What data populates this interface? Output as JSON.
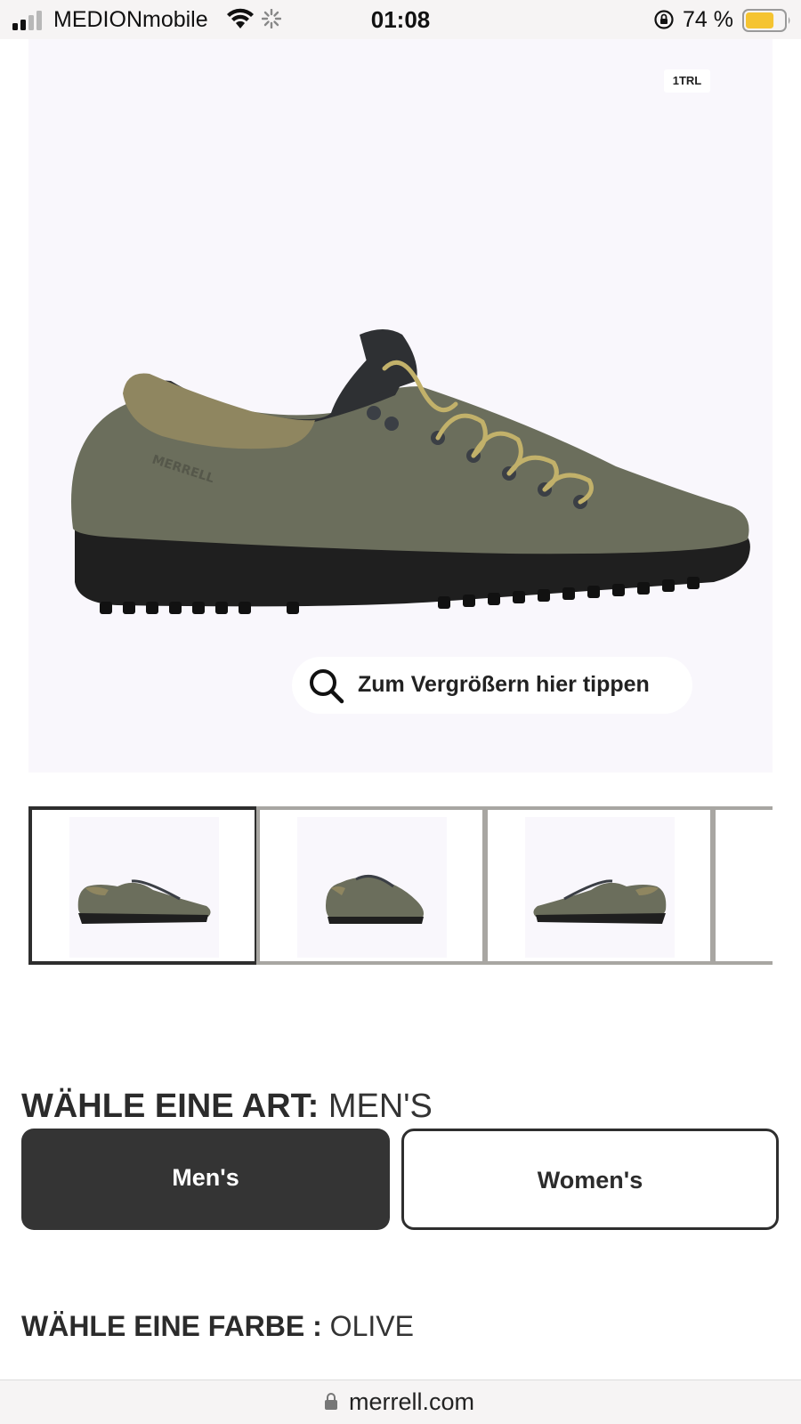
{
  "status_bar": {
    "carrier": "MEDIONmobile",
    "time": "01:08",
    "battery_percent": "74 %",
    "battery_level": 0.74,
    "signal_bars_filled": 2,
    "signal_bars_total": 4
  },
  "product": {
    "image_badge": "1TRL",
    "zoom_hint": "Zum Vergrößern hier tippen",
    "shoe_colors": {
      "suede": "#6b6e5c",
      "collar": "#8f8660",
      "sole": "#1f1f1f",
      "lace": "#c2b16a"
    }
  },
  "thumbnails": [
    {
      "view": "side-left",
      "active": true
    },
    {
      "view": "three-quarter-front",
      "active": false
    },
    {
      "view": "side-right",
      "active": false
    },
    {
      "view": "partial",
      "active": false
    }
  ],
  "type_selector": {
    "heading_label": "WÄHLE EINE ART:",
    "selected_value": "MEN'S",
    "options": [
      {
        "label": "Men's",
        "selected": true
      },
      {
        "label": "Women's",
        "selected": false
      }
    ]
  },
  "color_selector": {
    "heading_label": "WÄHLE EINE FARBE :",
    "selected_value": "OLIVE"
  },
  "url_bar": {
    "domain": "merrell.com"
  }
}
